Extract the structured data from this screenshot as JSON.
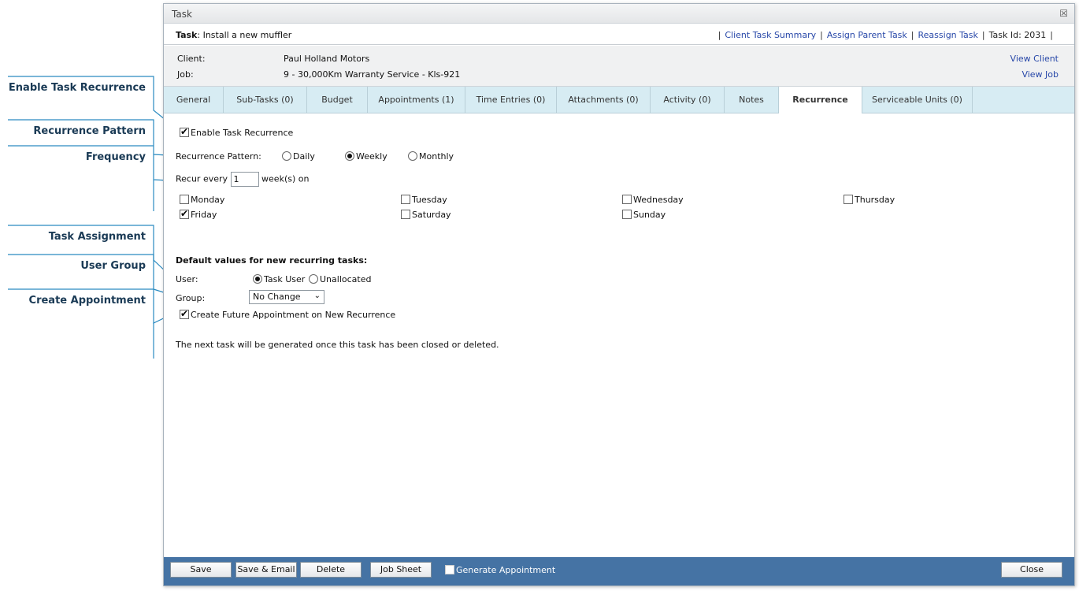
{
  "callouts": [
    {
      "label": "Enable Task Recurrence"
    },
    {
      "label": "Recurrence Pattern"
    },
    {
      "label": "Frequency"
    },
    {
      "label": "Task Assignment"
    },
    {
      "label": "User Group"
    },
    {
      "label": "Create Appointment"
    }
  ],
  "window": {
    "title": "Task",
    "task_label": "Task",
    "task_name": ": Install a new muffler",
    "links": {
      "client_task_summary": "Client Task Summary",
      "assign_parent_task": "Assign Parent Task",
      "reassign_task": "Reassign Task",
      "task_id": "Task Id: 2031",
      "sep": "|"
    }
  },
  "info": {
    "client_label": "Client:",
    "client_value": "Paul Holland Motors",
    "job_label": "Job:",
    "job_value": "9 - 30,000Km Warranty Service - Kls-921",
    "view_client": "View Client",
    "view_job": "View Job"
  },
  "tabs": [
    {
      "label": "General"
    },
    {
      "label": "Sub-Tasks (0)"
    },
    {
      "label": "Budget"
    },
    {
      "label": "Appointments (1)"
    },
    {
      "label": "Time Entries (0)"
    },
    {
      "label": "Attachments (0)"
    },
    {
      "label": "Activity (0)"
    },
    {
      "label": "Notes"
    },
    {
      "label": "Recurrence"
    },
    {
      "label": "Serviceable Units (0)"
    }
  ],
  "recurrence": {
    "enable_label": "Enable Task Recurrence",
    "pattern_label": "Recurrence Pattern:",
    "daily": "Daily",
    "weekly": "Weekly",
    "monthly": "Monthly",
    "recur_every": "Recur every",
    "recur_value": "1",
    "weeks_on": "week(s) on",
    "days": {
      "monday": "Monday",
      "tuesday": "Tuesday",
      "wednesday": "Wednesday",
      "thursday": "Thursday",
      "friday": "Friday",
      "saturday": "Saturday",
      "sunday": "Sunday"
    },
    "defaults_heading": "Default values for new recurring tasks:",
    "user_label": "User:",
    "task_user": "Task User",
    "unallocated": "Unallocated",
    "group_label": "Group:",
    "group_value": "No Change",
    "create_appt": "Create Future Appointment on New Recurrence",
    "note": "The next task will be generated once this task has been closed or deleted."
  },
  "footer": {
    "save": "Save",
    "save_email": "Save & Email",
    "delete": "Delete",
    "job_sheet": "Job Sheet",
    "generate_appt": "Generate Appointment",
    "close": "Close"
  },
  "colors": {
    "footer": "#4573a4",
    "tabs": "#d7ecf3",
    "link": "#2747a8",
    "callout": "#2a8ac0"
  }
}
